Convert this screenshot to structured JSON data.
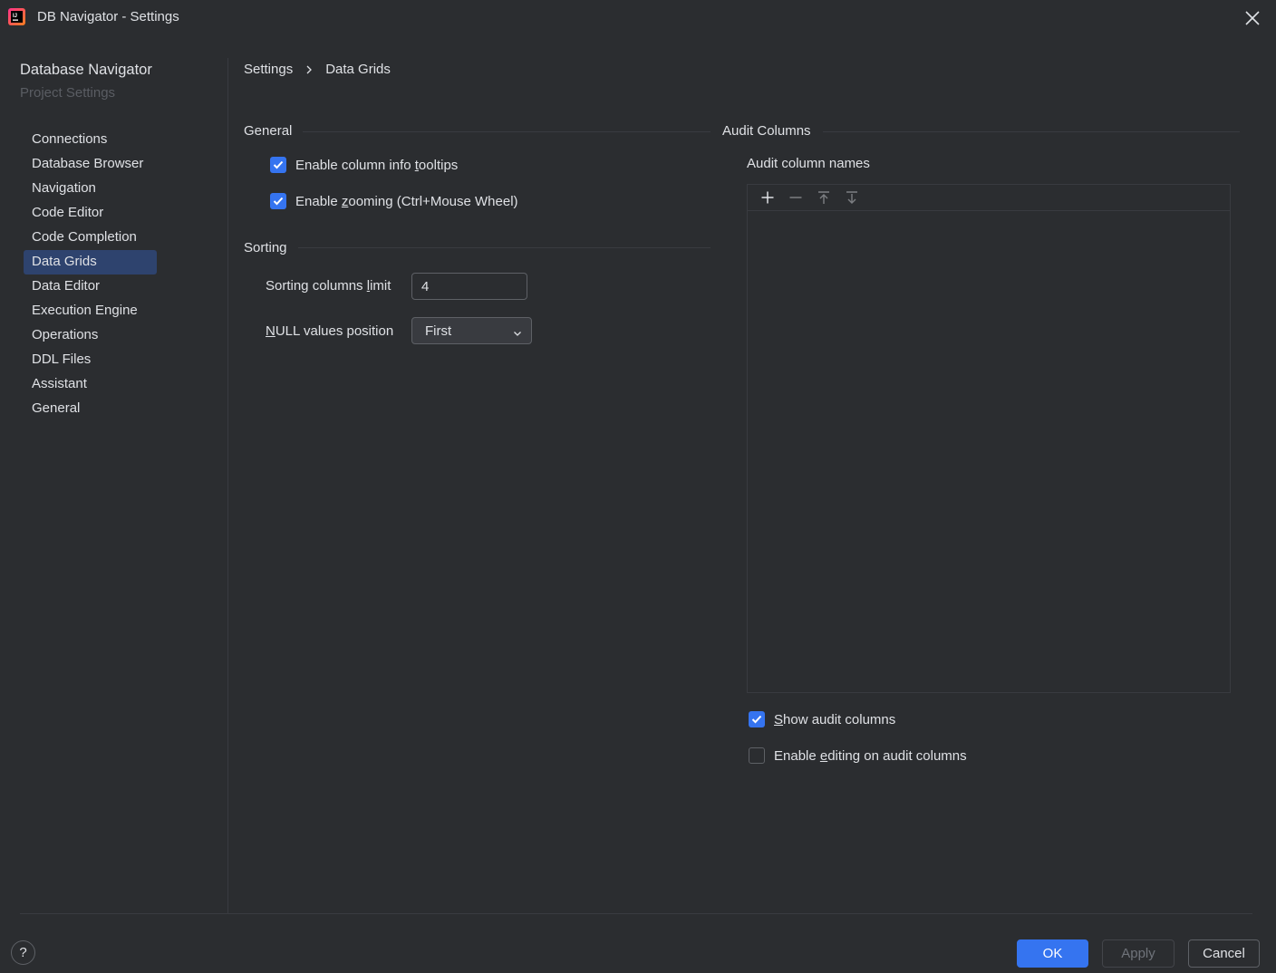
{
  "window": {
    "title": "DB Navigator - Settings"
  },
  "sidebar": {
    "title": "Database Navigator",
    "subtitle": "Project Settings",
    "items": [
      {
        "label": "Connections"
      },
      {
        "label": "Database Browser"
      },
      {
        "label": "Navigation"
      },
      {
        "label": "Code Editor"
      },
      {
        "label": "Code Completion"
      },
      {
        "label": "Data Grids"
      },
      {
        "label": "Data Editor"
      },
      {
        "label": "Execution Engine"
      },
      {
        "label": "Operations"
      },
      {
        "label": "DDL Files"
      },
      {
        "label": "Assistant"
      },
      {
        "label": "General"
      }
    ],
    "selected": "Data Grids"
  },
  "breadcrumb": {
    "root": "Settings",
    "current": "Data Grids"
  },
  "general": {
    "title": "General",
    "tooltips": {
      "pre": "Enable column info ",
      "mnemonic": "t",
      "post": "ooltips",
      "checked": true
    },
    "zooming": {
      "pre": "Enable ",
      "mnemonic": "z",
      "post": "ooming (Ctrl+Mouse Wheel)",
      "checked": true
    }
  },
  "sorting": {
    "title": "Sorting",
    "limit_label": {
      "pre": "Sorting columns ",
      "mnemonic": "l",
      "post": "imit"
    },
    "limit_value": "4",
    "null_label": {
      "pre": "",
      "mnemonic": "N",
      "post": "ULL values position"
    },
    "null_value": "First"
  },
  "audit": {
    "title": "Audit Columns",
    "names_label": "Audit column names",
    "toolbar": [
      "add-icon",
      "remove-icon",
      "move-up-icon",
      "move-down-icon"
    ],
    "show": {
      "pre": "",
      "mnemonic": "S",
      "post": "how audit columns",
      "checked": true
    },
    "editing": {
      "pre": "Enable ",
      "mnemonic": "e",
      "post": "diting on audit columns",
      "checked": false
    }
  },
  "footer": {
    "help": "?",
    "ok": "OK",
    "apply": "Apply",
    "cancel": "Cancel"
  },
  "colors": {
    "background": "#2b2d30",
    "accent": "#3574f0",
    "selection": "#2e436e",
    "separator": "#393b40"
  }
}
